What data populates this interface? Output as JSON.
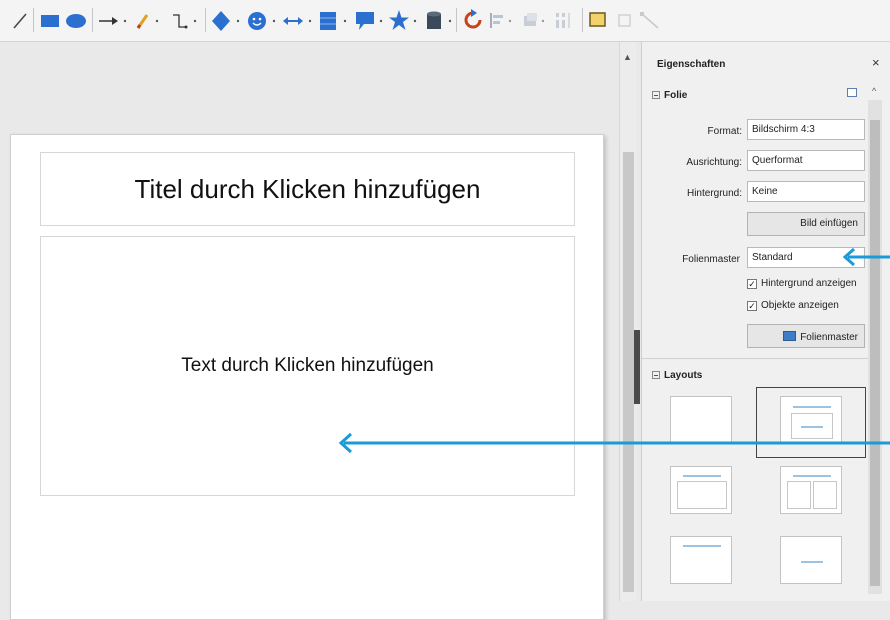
{
  "slide": {
    "title_placeholder": "Titel durch Klicken hinzufügen",
    "body_placeholder": "Text durch Klicken hinzufügen"
  },
  "sidebar": {
    "title": "Eigenschaften",
    "close_glyph": "×",
    "slide_section": {
      "heading": "Folie",
      "format": {
        "label": "Format:",
        "value": "Bildschirm 4:3"
      },
      "orientation": {
        "label": "Ausrichtung:",
        "value": "Querformat"
      },
      "background": {
        "label": "Hintergrund:",
        "value": "Keine"
      },
      "insert_image_label": "Bild einfügen",
      "master": {
        "label": "Folienmaster",
        "value": "Standard"
      },
      "show_background_label": "Hintergrund anzeigen",
      "show_objects_label": "Objekte anzeigen",
      "master_slides_label": "Folienmaster"
    },
    "layouts_section": {
      "heading": "Layouts",
      "items": [
        "blank",
        "title-content",
        "title-content-2",
        "title-2-content",
        "title-only",
        "centered-text"
      ]
    }
  },
  "icons": {
    "toolbar": [
      "line-icon",
      "rectangle-icon",
      "ellipse-icon",
      "arrow-line-icon",
      "freehand-icon",
      "connector-icon",
      "diamond-shape-icon",
      "smiley-icon",
      "double-arrow-icon",
      "flowchart-icon",
      "callout-icon",
      "star-icon",
      "cylinder-icon",
      "rotate-icon",
      "align-icon",
      "arrange-icon",
      "distribute-icon",
      "shadow-icon",
      "crop-icon",
      "points-icon"
    ]
  },
  "colors": {
    "annotation_arrow": "#1a9ad6",
    "shape_blue": "#2b6fd1"
  }
}
